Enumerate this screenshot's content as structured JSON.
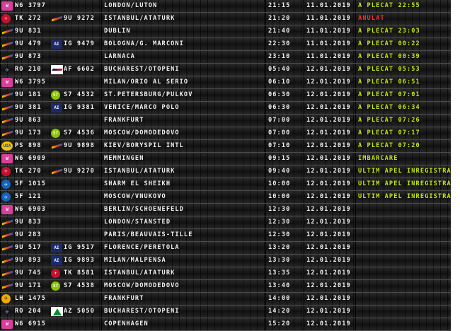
{
  "flights": [
    {
      "logo1": "wizzair-logo",
      "l1": "W",
      "code1": "W6 3797",
      "logo2": "",
      "l2": "",
      "code2": "",
      "destination": "LONDON/LUTON",
      "time": "21:15",
      "date": "11.01.2019",
      "status": "A PLECAT 22:55",
      "status_color": "#c4e612"
    },
    {
      "logo1": "turkish-airlines-logo",
      "l1": "✈",
      "code1": "TK 272",
      "logo2": "blue-air-logo",
      "l2": "",
      "code2": "9U 9272",
      "destination": "ISTANBUL/ATATURK",
      "time": "21:20",
      "date": "11.01.2019",
      "status": "ANULAT",
      "status_color": "#ff3030"
    },
    {
      "logo1": "blue-air-logo",
      "l1": "",
      "code1": "9U 831",
      "logo2": "",
      "l2": "",
      "code2": "",
      "destination": "DUBLIN",
      "time": "21:40",
      "date": "11.01.2019",
      "status": "A PLECAT 23:03",
      "status_color": "#c4e612"
    },
    {
      "logo1": "blue-air-logo",
      "l1": "",
      "code1": "9U 479",
      "logo2": "airitaly-logo",
      "l2": "AI",
      "code2": "IG 9479",
      "destination": "BOLOGNA/G. MARCONI",
      "time": "22:30",
      "date": "11.01.2019",
      "status": "A PLECAT 00:22",
      "status_color": "#c4e612"
    },
    {
      "logo1": "blue-air-logo",
      "l1": "",
      "code1": "9U 873",
      "logo2": "",
      "l2": "",
      "code2": "",
      "destination": "LARNACA",
      "time": "23:10",
      "date": "11.01.2019",
      "status": "A PLECAT 00:39",
      "status_color": "#c4e612"
    },
    {
      "logo1": "tarom-logo",
      "l1": "✈",
      "code1": "RO 210",
      "logo2": "air-france-logo",
      "l2": "",
      "code2": "AF 6602",
      "destination": "BUCHAREST/OTOPENI",
      "time": "05:40",
      "date": "12.01.2019",
      "status": "A PLECAT 05:53",
      "status_color": "#c4e612"
    },
    {
      "logo1": "wizzair-logo",
      "l1": "W",
      "code1": "W6 3795",
      "logo2": "",
      "l2": "",
      "code2": "",
      "destination": "MILAN/ORIO AL SERIO",
      "time": "06:10",
      "date": "12.01.2019",
      "status": "A PLECAT 06:51",
      "status_color": "#c4e612"
    },
    {
      "logo1": "blue-air-logo",
      "l1": "",
      "code1": "9U 181",
      "logo2": "s7-airlines-logo",
      "l2": "S7",
      "code2": "S7 4532",
      "destination": "ST.PETERSBURG/PULKOV",
      "time": "06:30",
      "date": "12.01.2019",
      "status": "A PLECAT 07:01",
      "status_color": "#c4e612"
    },
    {
      "logo1": "blue-air-logo",
      "l1": "",
      "code1": "9U 381",
      "logo2": "airitaly-logo",
      "l2": "AI",
      "code2": "IG 9381",
      "destination": "VENICE/MARCO POLO",
      "time": "06:30",
      "date": "12.01.2019",
      "status": "A PLECAT 06:34",
      "status_color": "#c4e612"
    },
    {
      "logo1": "blue-air-logo",
      "l1": "",
      "code1": "9U 863",
      "logo2": "",
      "l2": "",
      "code2": "",
      "destination": "FRANKFURT",
      "time": "07:00",
      "date": "12.01.2019",
      "status": "A PLECAT 07:26",
      "status_color": "#c4e612"
    },
    {
      "logo1": "blue-air-logo",
      "l1": "",
      "code1": "9U 173",
      "logo2": "s7-airlines-logo",
      "l2": "S7",
      "code2": "S7 4536",
      "destination": "MOSCOW/DOMODEDOVO",
      "time": "07:00",
      "date": "12.01.2019",
      "status": "A PLECAT 07:17",
      "status_color": "#c4e612"
    },
    {
      "logo1": "ukraine-international-logo",
      "l1": "UIA",
      "code1": "PS 898",
      "logo2": "blue-air-logo",
      "l2": "",
      "code2": "9U 9898",
      "destination": "KIEV/BORYSPIL INTL",
      "time": "07:10",
      "date": "12.01.2019",
      "status": "A PLECAT 07:20",
      "status_color": "#c4e612"
    },
    {
      "logo1": "wizzair-logo",
      "l1": "W",
      "code1": "W6 6909",
      "logo2": "",
      "l2": "",
      "code2": "",
      "destination": "MEMMINGEN",
      "time": "09:15",
      "date": "12.01.2019",
      "status": "IMBARCARE",
      "status_color": "#c4e612"
    },
    {
      "logo1": "turkish-airlines-logo",
      "l1": "✈",
      "code1": "TK 270",
      "logo2": "blue-air-logo",
      "l2": "",
      "code2": "9U 9270",
      "destination": "ISTANBUL/ATATURK",
      "time": "09:40",
      "date": "12.01.2019",
      "status": "ULTIM APEL INREGISTRA",
      "status_color": "#c4e612"
    },
    {
      "logo1": "sunexpress-logo",
      "l1": "✈",
      "code1": "5F 1015",
      "logo2": "",
      "l2": "",
      "code2": "",
      "destination": "SHARM EL SHEIKH",
      "time": "10:00",
      "date": "12.01.2019",
      "status": "ULTIM APEL INREGISTRA",
      "status_color": "#c4e612"
    },
    {
      "logo1": "sunexpress-logo",
      "l1": "✈",
      "code1": "5F 121",
      "logo2": "",
      "l2": "",
      "code2": "",
      "destination": "MOSCOW/VNUKOVO",
      "time": "10:00",
      "date": "12.01.2019",
      "status": "ULTIM APEL INREGISTRA",
      "status_color": "#c4e612"
    },
    {
      "logo1": "wizzair-logo",
      "l1": "W",
      "code1": "W6 6903",
      "logo2": "",
      "l2": "",
      "code2": "",
      "destination": "BERLIN/SCHOENEFELD",
      "time": "12:30",
      "date": "12.01.2019",
      "status": "",
      "status_color": "#c4e612"
    },
    {
      "logo1": "blue-air-logo",
      "l1": "",
      "code1": "9U 833",
      "logo2": "",
      "l2": "",
      "code2": "",
      "destination": "LONDON/STANSTED",
      "time": "12:30",
      "date": "12.01.2019",
      "status": "",
      "status_color": "#c4e612"
    },
    {
      "logo1": "blue-air-logo",
      "l1": "",
      "code1": "9U 283",
      "logo2": "",
      "l2": "",
      "code2": "",
      "destination": "PARIS/BEAUVAIS-TILLE",
      "time": "12:30",
      "date": "12.01.2019",
      "status": "",
      "status_color": "#c4e612"
    },
    {
      "logo1": "blue-air-logo",
      "l1": "",
      "code1": "9U 517",
      "logo2": "airitaly-logo",
      "l2": "AI",
      "code2": "IG 9517",
      "destination": "FLORENCE/PERETOLA",
      "time": "13:20",
      "date": "12.01.2019",
      "status": "",
      "status_color": "#c4e612"
    },
    {
      "logo1": "blue-air-logo",
      "l1": "",
      "code1": "9U 893",
      "logo2": "airitaly-logo",
      "l2": "AI",
      "code2": "IG 9893",
      "destination": "MILAN/MALPENSA",
      "time": "13:30",
      "date": "12.01.2019",
      "status": "",
      "status_color": "#c4e612"
    },
    {
      "logo1": "blue-air-logo",
      "l1": "",
      "code1": "9U 745",
      "logo2": "turkish-airlines-logo",
      "l2": "✈",
      "code2": "TK 8581",
      "destination": "ISTANBUL/ATATURK",
      "time": "13:35",
      "date": "12.01.2019",
      "status": "",
      "status_color": "#c4e612"
    },
    {
      "logo1": "blue-air-logo",
      "l1": "",
      "code1": "9U 171",
      "logo2": "s7-airlines-logo",
      "l2": "S7",
      "code2": "S7 4538",
      "destination": "MOSCOW/DOMODEDOVO",
      "time": "13:40",
      "date": "12.01.2019",
      "status": "",
      "status_color": "#c4e612"
    },
    {
      "logo1": "lufthansa-logo",
      "l1": "✈",
      "code1": "LH 1475",
      "logo2": "",
      "l2": "",
      "code2": "",
      "destination": "FRANKFURT",
      "time": "14:00",
      "date": "12.01.2019",
      "status": "",
      "status_color": "#c4e612"
    },
    {
      "logo1": "tarom-logo",
      "l1": "✈",
      "code1": "RO 204",
      "logo2": "alitalia-logo",
      "l2": "",
      "code2": "AZ 5050",
      "destination": "BUCHAREST/OTOPENI",
      "time": "14:20",
      "date": "12.01.2019",
      "status": "",
      "status_color": "#c4e612"
    },
    {
      "logo1": "wizzair-logo",
      "l1": "W",
      "code1": "W6 6915",
      "logo2": "",
      "l2": "",
      "code2": "",
      "destination": "COPENHAGEN",
      "time": "15:20",
      "date": "12.01.2019",
      "status": "",
      "status_color": "#c4e612"
    }
  ]
}
